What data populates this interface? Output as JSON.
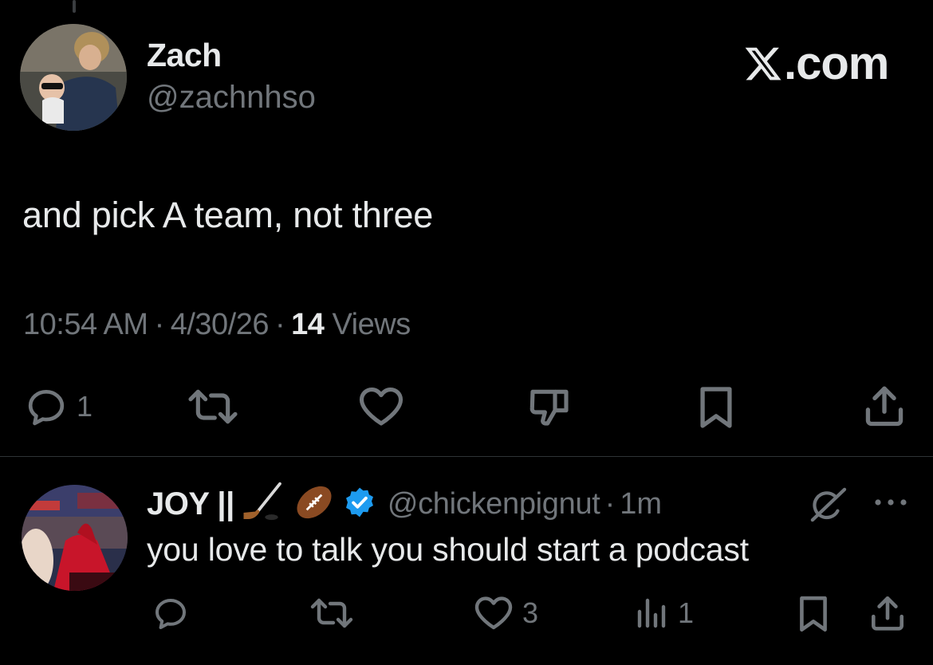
{
  "tweet": {
    "author_name": "Zach",
    "author_handle": "@zachnhso",
    "text": "and pick A team, not three",
    "time": "10:54 AM",
    "date": "4/30/26",
    "views_count": "14",
    "views_label": "Views",
    "separator": "·",
    "actions": {
      "reply_count": "1",
      "icons": [
        "reply-icon",
        "retweet-icon",
        "like-icon",
        "dislike-icon",
        "bookmark-icon",
        "share-icon"
      ]
    }
  },
  "brand": {
    "text": ".com",
    "logo": "x-logo-icon"
  },
  "reply": {
    "author_name": "JOY ||",
    "author_emojis": [
      "hockey-stick-icon",
      "football-icon",
      "verified-badge-icon"
    ],
    "author_handle": "@chickenpignut",
    "separator": "·",
    "time": "1m",
    "text": "you love to talk you should start a podcast",
    "actions": {
      "like_count": "3",
      "views_count": "1",
      "icons": [
        "reply-icon",
        "retweet-icon",
        "like-icon",
        "views-icon",
        "bookmark-icon",
        "share-icon"
      ]
    }
  },
  "colors": {
    "background": "#000000",
    "text_primary": "#e7e9ea",
    "text_secondary": "#71767b",
    "divider": "#2f3336",
    "verified": "#1d9bf0"
  }
}
